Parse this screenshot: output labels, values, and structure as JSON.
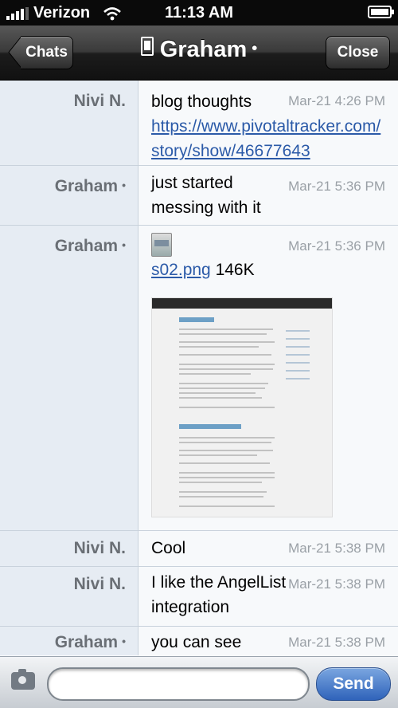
{
  "status_bar": {
    "carrier": "Verizon",
    "time": "11:13 AM"
  },
  "nav": {
    "back_label": "Chats",
    "title": "Graham",
    "close_label": "Close"
  },
  "messages": [
    {
      "sender": "Nivi N.",
      "time": "Mar-21 4:26 PM",
      "text": "blog thoughts",
      "link": "https://www.pivotaltracker.com/story/show/46677643"
    },
    {
      "sender": "Graham",
      "time": "Mar-21 5:36 PM",
      "text": "just started messing with it"
    },
    {
      "sender": "Graham",
      "time": "Mar-21 5:36 PM",
      "file_name": "s02.png",
      "file_size": "146K"
    },
    {
      "sender": "Nivi N.",
      "time": "Mar-21 5:38 PM",
      "text": "Cool"
    },
    {
      "sender": "Nivi N.",
      "time": "Mar-21 5:38 PM",
      "text": "I like the AngelList integration"
    },
    {
      "sender": "Graham",
      "time": "Mar-21 5:38 PM",
      "text": "you can see"
    }
  ],
  "compose": {
    "send_label": "Send"
  },
  "colors": {
    "link": "#2b5aa8",
    "send_button": "#2f63ba",
    "navbar": "#1c1c1c"
  }
}
